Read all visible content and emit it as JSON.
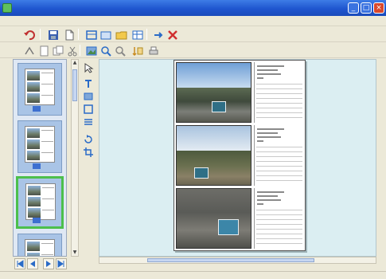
{
  "window": {
    "title": ""
  },
  "menu": {
    "items": [
      "",
      "",
      "",
      "",
      "",
      "",
      "",
      "",
      ""
    ]
  },
  "document": {
    "entries": [
      {
        "scene": "road"
      },
      {
        "scene": "field"
      },
      {
        "scene": "gravel"
      }
    ]
  },
  "thumbnails": {
    "count": 4,
    "selected_index": 2
  },
  "zoom": {
    "label": ""
  },
  "status": {
    "left": "",
    "right": ""
  },
  "colors": {
    "title_bar": "#1f56cf",
    "canvas_bg": "#dbeef2",
    "thumb_bg": "#a9c4e6",
    "selection": "#4cbf4c"
  }
}
